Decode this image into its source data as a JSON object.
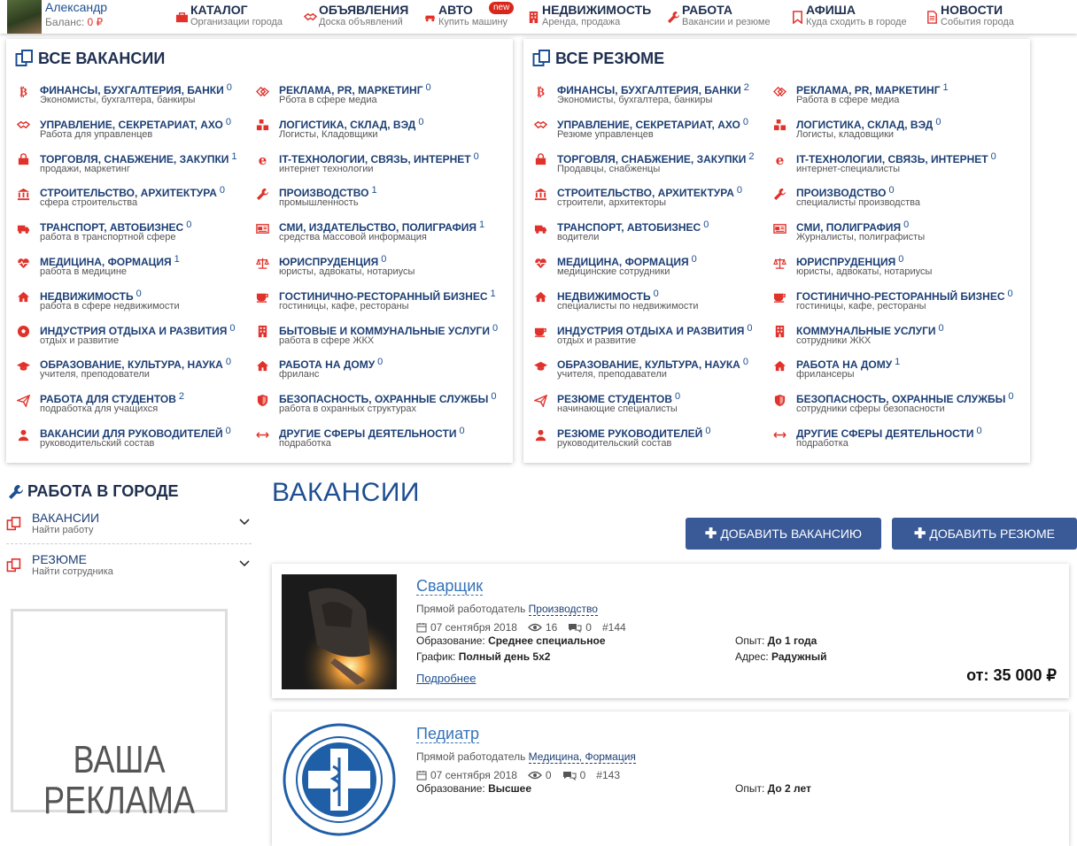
{
  "header": {
    "user_name": "Александр",
    "balance_label": "Баланс:",
    "balance_value": "0 ₽",
    "new_badge": "new",
    "nav": [
      {
        "title": "КАТАЛОГ",
        "sub": "Организации города",
        "icon": "briefcase-icon"
      },
      {
        "title": "ОБЪЯВЛЕНИЯ",
        "sub": "Доска объявлений",
        "icon": "handshake-icon"
      },
      {
        "title": "АВТО",
        "sub": "Купить машину",
        "icon": "car-icon"
      },
      {
        "title": "НЕДВИЖИМОСТЬ",
        "sub": "Аренда, продажа",
        "icon": "building-icon"
      },
      {
        "title": "РАБОТА",
        "sub": "Вакансии и резюме",
        "icon": "wrench-icon"
      },
      {
        "title": "АФИША",
        "sub": "Куда сходить в городе",
        "icon": "bookmark-icon"
      },
      {
        "title": "НОВОСТИ",
        "sub": "События города",
        "icon": "document-icon"
      }
    ]
  },
  "vacancies_panel": {
    "title": "ВСЕ ВАКАНСИИ",
    "items": [
      {
        "name": "ФИНАНСЫ, БУХГАЛТЕРИЯ, БАНКИ",
        "count": "0",
        "sub": "Экономисты, бухгалтера, банкиры",
        "icon": "bitcoin-icon"
      },
      {
        "name": "УПРАВЛЕНИЕ, СЕКРЕТАРИАТ, АХО",
        "count": "0",
        "sub": "Работа для управленцев",
        "icon": "handshake-icon"
      },
      {
        "name": "ТОРГОВЛЯ, СНАБЖЕНИЕ, ЗАКУПКИ",
        "count": "1",
        "sub": "продажи, маркетинг",
        "icon": "shopping-bag-icon"
      },
      {
        "name": "СТРОИТЕЛЬСТВО, АРХИТЕКТУРА",
        "count": "0",
        "sub": "сфера строительства",
        "icon": "bank-icon"
      },
      {
        "name": "ТРАНСПОРТ, АВТОБИЗНЕС",
        "count": "0",
        "sub": "работа в транспортной сфере",
        "icon": "truck-icon"
      },
      {
        "name": "МЕДИЦИНА, ФОРМАЦИЯ",
        "count": "1",
        "sub": "работа в медицине",
        "icon": "heartbeat-icon"
      },
      {
        "name": "НЕДВИЖИМОСТЬ",
        "count": "0",
        "sub": "работа в сфере недвижимости",
        "icon": "home-icon"
      },
      {
        "name": "ИНДУСТРИЯ ОТДЫХА И РАЗВИТИЯ",
        "count": "0",
        "sub": "отдых и развитие",
        "icon": "soccer-ball-icon"
      },
      {
        "name": "ОБРАЗОВАНИЕ, КУЛЬТУРА, НАУКА",
        "count": "0",
        "sub": "учителя, преподователи",
        "icon": "graduation-cap-icon"
      },
      {
        "name": "РАБОТА ДЛЯ СТУДЕНТОВ",
        "count": "2",
        "sub": "подработка для учащихся",
        "icon": "paper-plane-icon"
      },
      {
        "name": "ВАКАНСИИ ДЛЯ РУКОВОДИТЕЛЕЙ",
        "count": "0",
        "sub": "руководительский состав",
        "icon": "user-icon"
      },
      {
        "name": "РЕКЛАМА, PR, МАРКЕТИНГ",
        "count": "0",
        "sub": "Рбота в сфере медиа",
        "icon": "diamond-icon"
      },
      {
        "name": "ЛОГИСТИКА, СКЛАД, ВЭД",
        "count": "0",
        "sub": "Логисты, Кладовщики",
        "icon": "boxes-icon"
      },
      {
        "name": "IT-ТЕХНОЛОГИИ, СВЯЗЬ, ИНТЕРНЕТ",
        "count": "0",
        "sub": "интернет технологии",
        "icon": "ie-icon"
      },
      {
        "name": "ПРОИЗВОДСТВО",
        "count": "1",
        "sub": "промышленность",
        "icon": "wrench-icon"
      },
      {
        "name": "СМИ, ИЗДАТЕЛЬСТВО, ПОЛИГРАФИЯ",
        "count": "1",
        "sub": "средства массовой информация",
        "icon": "newspaper-icon"
      },
      {
        "name": "ЮРИСПРУДЕНЦИЯ",
        "count": "0",
        "sub": "юристы, адвокаты, нотариусы",
        "icon": "scales-icon"
      },
      {
        "name": "ГОСТИНИЧНО-РЕСТОРАННЫЙ БИЗНЕС",
        "count": "1",
        "sub": "гостиницы, кафе, рестораны",
        "icon": "coffee-icon"
      },
      {
        "name": "БЫТОВЫЕ И КОММУНАЛЬНЫЕ УСЛУГИ",
        "count": "0",
        "sub": "работа в сфере ЖКХ",
        "icon": "building-icon"
      },
      {
        "name": "РАБОТА НА ДОМУ",
        "count": "0",
        "sub": "фриланс",
        "icon": "home-icon"
      },
      {
        "name": "БЕЗОПАСНОСТЬ, ОХРАННЫЕ СЛУЖБЫ",
        "count": "0",
        "sub": "работа в охранных структурах",
        "icon": "shield-icon"
      },
      {
        "name": "ДРУГИЕ СФЕРЫ ДЕЯТЕЛЬНОСТИ",
        "count": "0",
        "sub": "подработка",
        "icon": "arrows-h-icon"
      }
    ]
  },
  "resumes_panel": {
    "title": "ВСЕ РЕЗЮМЕ",
    "items": [
      {
        "name": "ФИНАНСЫ, БУХГАЛТЕРИЯ, БАНКИ",
        "count": "2",
        "sub": "Экономисты, бухгалтера, банкиры",
        "icon": "bitcoin-icon"
      },
      {
        "name": "УПРАВЛЕНИЕ, СЕКРЕТАРИАТ, АХО",
        "count": "0",
        "sub": "Резюме управленцев",
        "icon": "handshake-icon"
      },
      {
        "name": "ТОРГОВЛЯ, СНАБЖЕНИЕ, ЗАКУПКИ",
        "count": "2",
        "sub": "Продавцы, снабженцы",
        "icon": "shopping-bag-icon"
      },
      {
        "name": "СТРОИТЕЛЬСТВО, АРХИТЕКТУРА",
        "count": "0",
        "sub": "строители, архитекторы",
        "icon": "bank-icon"
      },
      {
        "name": "ТРАНСПОРТ, АВТОБИЗНЕС",
        "count": "0",
        "sub": "водители",
        "icon": "truck-icon"
      },
      {
        "name": "МЕДИЦИНА, ФОРМАЦИЯ",
        "count": "0",
        "sub": "медицинские сотрудники",
        "icon": "heartbeat-icon"
      },
      {
        "name": "НЕДВИЖИМОСТЬ",
        "count": "0",
        "sub": "специалисты по недвижимости",
        "icon": "home-icon"
      },
      {
        "name": "ИНДУСТРИЯ ОТДЫХА И РАЗВИТИЯ",
        "count": "0",
        "sub": "отдых и развитие",
        "icon": "coffee-icon"
      },
      {
        "name": "ОБРАЗОВАНИЕ, КУЛЬТУРА, НАУКА",
        "count": "0",
        "sub": "учителя, преподаватели",
        "icon": "graduation-cap-icon"
      },
      {
        "name": "РЕЗЮМЕ СТУДЕНТОВ",
        "count": "0",
        "sub": "начинающие специалисты",
        "icon": "paper-plane-icon"
      },
      {
        "name": "РЕЗЮМЕ РУКОВОДИТЕЛЕЙ",
        "count": "0",
        "sub": "руководительский состав",
        "icon": "user-icon"
      },
      {
        "name": "РЕКЛАМА, PR, МАРКЕТИНГ",
        "count": "1",
        "sub": "Работа в сфере медиа",
        "icon": "diamond-icon"
      },
      {
        "name": "ЛОГИСТИКА, СКЛАД, ВЭД",
        "count": "0",
        "sub": "Логисты, кладовщики",
        "icon": "boxes-icon"
      },
      {
        "name": "IT-ТЕХНОЛОГИИ, СВЯЗЬ, ИНТЕРНЕТ",
        "count": "0",
        "sub": "интернет-специалисты",
        "icon": "ie-icon"
      },
      {
        "name": "ПРОИЗВОДСТВО",
        "count": "0",
        "sub": "специалисты производства",
        "icon": "wrench-icon"
      },
      {
        "name": "СМИ, ПОЛИГРАФИЯ",
        "count": "0",
        "sub": "Журналисты, полиграфисты",
        "icon": "newspaper-icon"
      },
      {
        "name": "ЮРИСПРУДЕНЦИЯ",
        "count": "0",
        "sub": "юристы, адвокаты, нотариусы",
        "icon": "scales-icon"
      },
      {
        "name": "ГОСТИНИЧНО-РЕСТОРАННЫЙ БИЗНЕС",
        "count": "0",
        "sub": "гостиницы, кафе, рестораны",
        "icon": "coffee-icon"
      },
      {
        "name": "КОММУНАЛЬНЫЕ УСЛУГИ",
        "count": "0",
        "sub": "сотрудники ЖКХ",
        "icon": "building-icon"
      },
      {
        "name": "РАБОТА НА ДОМУ",
        "count": "1",
        "sub": "фрилансеры",
        "icon": "home-icon"
      },
      {
        "name": "БЕЗОПАСНОСТЬ, ОХРАННЫЕ СЛУЖБЫ",
        "count": "0",
        "sub": "сотрудники сферы безопасности",
        "icon": "shield-icon"
      },
      {
        "name": "ДРУГИЕ СФЕРЫ ДЕЯТЕЛЬНОСТИ",
        "count": "0",
        "sub": "подработка",
        "icon": "arrows-h-icon"
      }
    ]
  },
  "sidebar": {
    "title": "РАБОТА В ГОРОДЕ",
    "items": [
      {
        "label": "ВАКАНСИИ",
        "sub": "Найти работу"
      },
      {
        "label": "РЕЗЮМЕ",
        "sub": "Найти сотрудника"
      }
    ],
    "ad_text": "ВАША РЕКЛАМА"
  },
  "main": {
    "title": "ВАКАНСИИ",
    "add_vacancy": "ДОБАВИТЬ ВАКАНСИЮ",
    "add_resume": "ДОБАВИТЬ РЕЗЮМЕ",
    "jobs": [
      {
        "title": "Сварщик",
        "employer_label": "Прямой работодатель",
        "category": "Производство",
        "date": "07 сентября 2018",
        "views": "16",
        "comments": "0",
        "id": "#144",
        "education_label": "Образование:",
        "education": "Среднее специальное",
        "schedule_label": "График:",
        "schedule": "Полный день 5х2",
        "experience_label": "Опыт:",
        "experience": "До 1 года",
        "address_label": "Адрес:",
        "address": "Радужный",
        "more": "Подробнее",
        "salary": "от: 35 000 ₽"
      },
      {
        "title": "Педиатр",
        "employer_label": "Прямой работодатель",
        "category": "Медицина, Формация",
        "date": "07 сентября 2018",
        "views": "0",
        "comments": "0",
        "id": "#143",
        "education_label": "Образование:",
        "education": "Высшее",
        "experience_label": "Опыт:",
        "experience": "До 2 лет"
      }
    ]
  },
  "colors": {
    "accent_red": "#e0322b",
    "link_blue": "#1d4f91",
    "button_blue": "#3a5a97",
    "title_dark": "#1f2f4f"
  }
}
